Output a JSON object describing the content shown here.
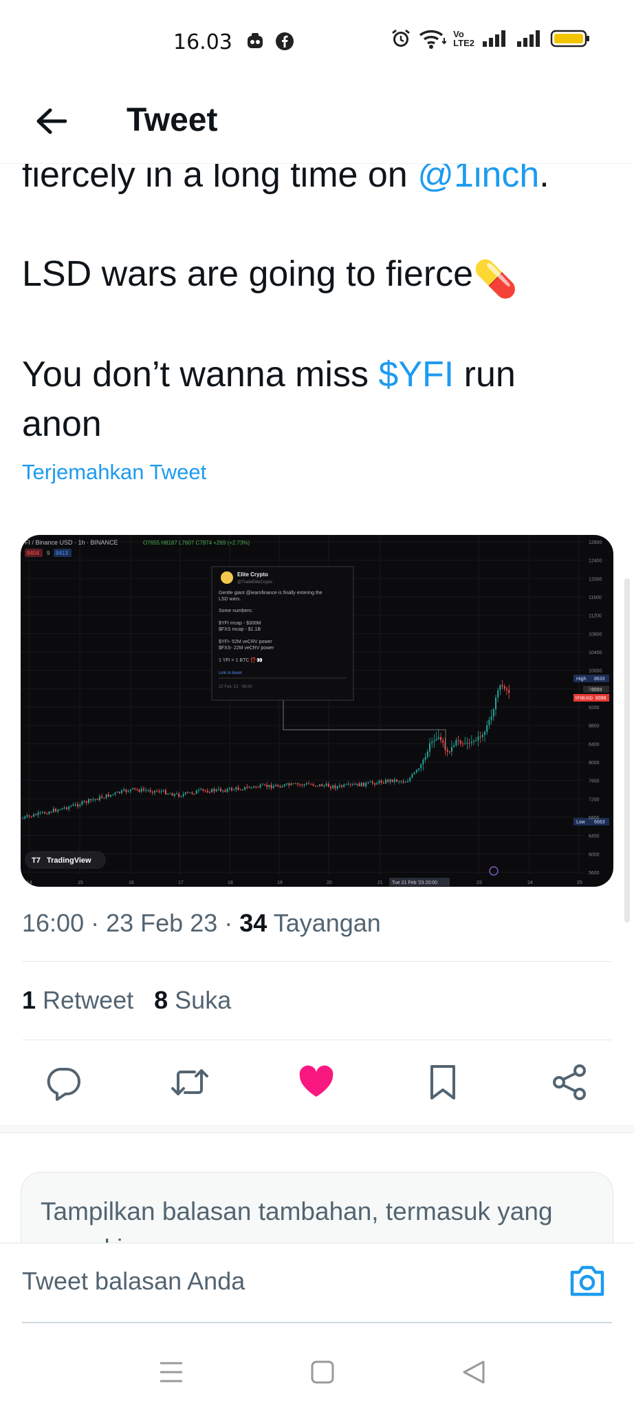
{
  "status_bar": {
    "time": "16.03",
    "volte": "Vo",
    "lte": "LTE2"
  },
  "header": {
    "title": "Tweet"
  },
  "tweet": {
    "line1_prefix": "fiercely in a long time on ",
    "line1_mention": "@1inch",
    "line1_suffix": ".",
    "line2": "LSD wars are going to fierce",
    "line2_emoji": "💊",
    "line3_prefix": "You don’t wanna miss ",
    "line3_cashtag": "$YFI",
    "line3_suffix": " run",
    "line4": "anon",
    "translate_label": "Terjemahkan Tweet"
  },
  "media": {
    "symbol_line": "FI / Binance USD · 1h · BINANCE",
    "ohlc": "O7655 H8187 L7607 C7874 +269 (+2.73%)",
    "badge_sell": "8404",
    "badge_num": "9",
    "badge_buy": "8413",
    "tv_logo": "TradingView",
    "card_name": "Elite Crypto",
    "card_handle": "@TradeEliteCrypto",
    "card_text1": "Gentle giant @iearnfinance is finally entering the",
    "card_text2": "LSD wars.",
    "card_text3": "Some numbers:",
    "card_text4": "$YFI mcap - $300M",
    "card_text5": "$FXS mcap - $1.1B",
    "card_text6": "$YFI- 52M veCRV power",
    "card_text7": "$FXS- 22M veCRV power",
    "card_text8": "1 YFI = 1 BTC ⁉️👀",
    "card_link": "Link to tweet",
    "card_date": "22 Feb '23 · 08:00",
    "high_label": "High",
    "high_value": "8633",
    "current_symbol": "YFIBUSD",
    "current_value": "8398",
    "mid_value": "9559",
    "low_label": "Low",
    "low_value": "6663",
    "date_marker": "Tue 21 Feb '23   20:00",
    "price_ticks": [
      "12800",
      "12400",
      "12000",
      "11600",
      "11200",
      "10800",
      "10400",
      "10000",
      "9600",
      "9200",
      "8800",
      "8400",
      "8000",
      "7600",
      "7200",
      "6800",
      "6450",
      "6000",
      "5600"
    ],
    "date_ticks": [
      "14",
      "15",
      "16",
      "17",
      "18",
      "19",
      "20",
      "21",
      "23",
      "24",
      "25"
    ]
  },
  "meta": {
    "time": "16:00",
    "date": "23 Feb 23",
    "views_count": "34",
    "views_label": "Tayangan",
    "sep": "·"
  },
  "stats": {
    "retweets_count": "1",
    "retweets_label": "Retweet",
    "likes_count": "8",
    "likes_label": "Suka"
  },
  "more_replies": {
    "text": "Tampilkan balasan tambahan, termasuk yang mungkin"
  },
  "reply": {
    "placeholder": "Tweet balasan Anda"
  },
  "colors": {
    "accent": "#1d9bf0",
    "like": "#f91880",
    "text_secondary": "#536471"
  },
  "icons": [
    "back-arrow-icon",
    "reply-icon",
    "retweet-icon",
    "like-icon",
    "bookmark-icon",
    "share-icon",
    "camera-icon",
    "menu-icon",
    "home-icon",
    "back-icon"
  ]
}
